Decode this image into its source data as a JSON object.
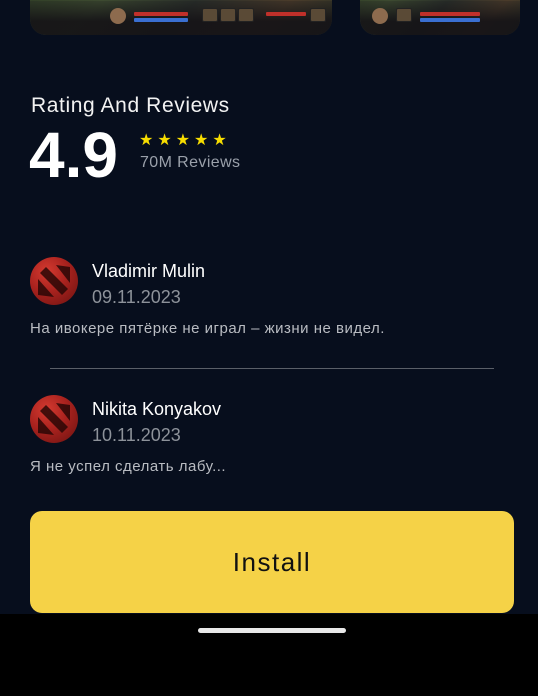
{
  "gallery": {
    "screenshots": [
      {
        "icon": "game-screenshot"
      },
      {
        "icon": "game-screenshot"
      }
    ]
  },
  "ratings": {
    "title": "Rating And Reviews",
    "score": "4.9",
    "stars": "★★★★★",
    "star_count": 5,
    "count_label": "70M Reviews"
  },
  "reviews": [
    {
      "avatar_icon": "dota-logo-icon",
      "name": "Vladimir Mulin",
      "date": "09.11.2023",
      "text": "На ивокере пятёрке не играл – жизни не видел."
    },
    {
      "avatar_icon": "dota-logo-icon",
      "name": "Nikita Konyakov",
      "date": "10.11.2023",
      "text": "Я не успел сделать лабу..."
    }
  ],
  "install": {
    "label": "Install"
  },
  "colors": {
    "background": "#070e1d",
    "accent": "#f5d247",
    "star": "#f7dd00",
    "avatar": "#b8261f"
  }
}
